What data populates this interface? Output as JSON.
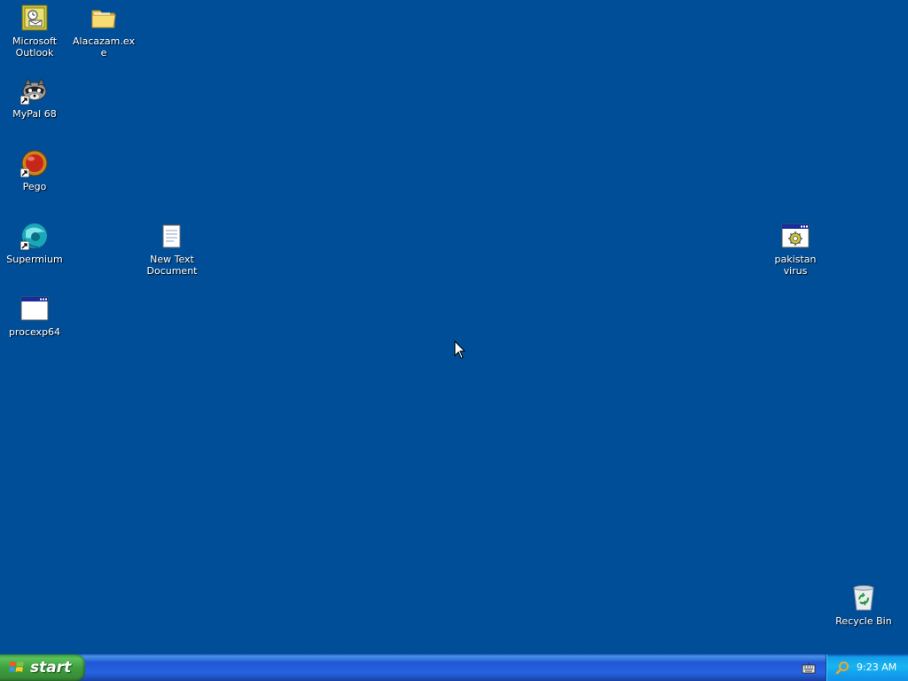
{
  "desktop": {
    "icons": [
      {
        "label": "Microsoft\nOutlook",
        "icon": "outlook-icon"
      },
      {
        "label": "Alacazam.exe",
        "icon": "folder-icon"
      },
      {
        "label": "MyPal 68",
        "icon": "raccoon-icon"
      },
      {
        "label": "Pego",
        "icon": "red-ball-icon"
      },
      {
        "label": "Supermium",
        "icon": "supermium-icon"
      },
      {
        "label": "New Text\nDocument",
        "icon": "text-document-icon"
      },
      {
        "label": "procexp64",
        "icon": "application-window-icon"
      },
      {
        "label": "pakistan virus",
        "icon": "application-gear-icon"
      },
      {
        "label": "Recycle Bin",
        "icon": "recycle-bin-icon"
      }
    ]
  },
  "taskbar": {
    "start_label": "start",
    "clock": "9:23 AM"
  },
  "colors": {
    "desktop_background": "#004e98",
    "taskbar_blue": "#2663e0",
    "start_green": "#3f9f3f",
    "tray_blue": "#18b5f2"
  }
}
